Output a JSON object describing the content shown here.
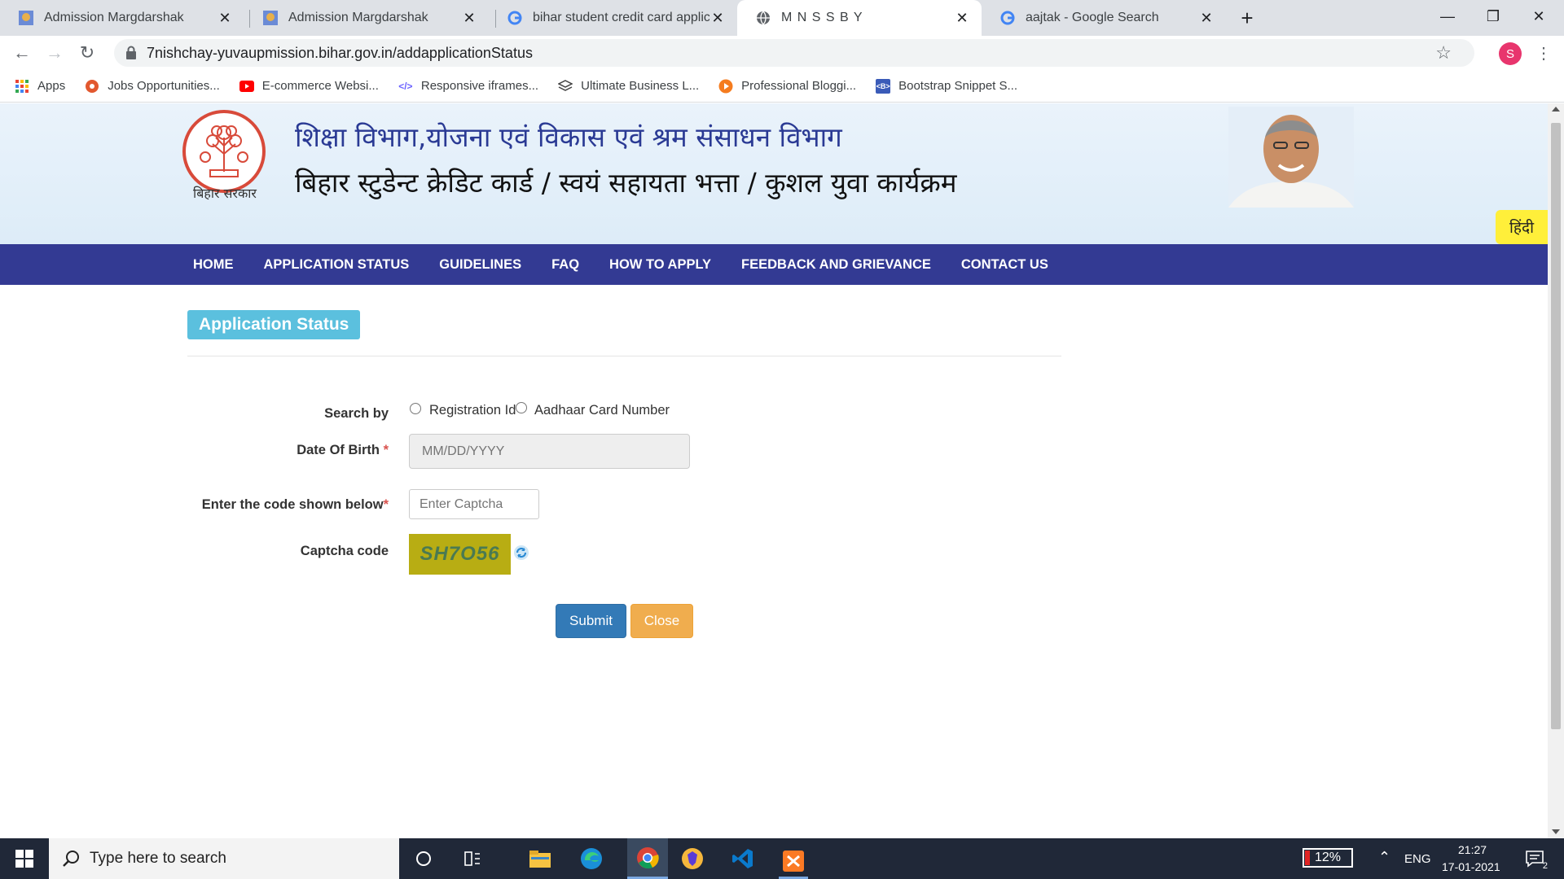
{
  "browser": {
    "tabs": [
      {
        "title": "Admission Margdarshak",
        "icon": "site-favicon"
      },
      {
        "title": "Admission Margdarshak",
        "icon": "site-favicon"
      },
      {
        "title": "bihar student credit card applicat",
        "icon": "google-g-icon"
      },
      {
        "title": "M N S S B Y",
        "icon": "globe-icon",
        "active": true
      },
      {
        "title": "aajtak - Google Search",
        "icon": "google-g-icon"
      }
    ],
    "url": "7nishchay-yuvaupmission.bihar.gov.in/addapplicationStatus",
    "profile_initial": "S",
    "bookmarks": [
      {
        "label": "Apps",
        "icon": "apps-grid-icon"
      },
      {
        "label": "Jobs Opportunities...",
        "icon": "jobs-icon"
      },
      {
        "label": "E-commerce Websi...",
        "icon": "youtube-icon"
      },
      {
        "label": "Responsive iframes...",
        "icon": "code-icon"
      },
      {
        "label": "Ultimate Business L...",
        "icon": "layers-icon"
      },
      {
        "label": "Professional Bloggi...",
        "icon": "play-circle-icon"
      },
      {
        "label": "Bootstrap Snippet S...",
        "icon": "bootstrap-icon"
      }
    ]
  },
  "header": {
    "emblem_text": "बिहार सरकार",
    "department": "शिक्षा विभाग,योजना एवं विकास एवं श्रम संसाधन विभाग",
    "scheme": "बिहार स्टुडेन्ट क्रेडिट कार्ड / स्वयं सहायता भत्ता / कुशल युवा कार्यक्रम",
    "language_toggle": "हिंदी"
  },
  "nav": {
    "items": [
      "HOME",
      "APPLICATION STATUS",
      "GUIDELINES",
      "FAQ",
      "HOW TO APPLY",
      "FEEDBACK AND GRIEVANCE",
      "CONTACT US"
    ]
  },
  "form": {
    "heading": "Application Status",
    "search_by_label": "Search by",
    "option_registration": "Registration Id",
    "option_aadhaar": "Aadhaar Card Number",
    "dob_label": "Date Of Birth",
    "dob_placeholder": "MM/DD/YYYY",
    "captcha_input_label": "Enter the code shown below",
    "captcha_placeholder": "Enter Captcha",
    "captcha_label": "Captcha code",
    "captcha_value": "SH7O56",
    "required_mark": "*",
    "submit_label": "Submit",
    "close_label": "Close"
  },
  "taskbar": {
    "search_placeholder": "Type here to search",
    "battery": "12%",
    "language": "ENG",
    "time": "21:27",
    "date": "17-01-2021",
    "notifications": "2"
  },
  "colors": {
    "nav_bg": "#333a93",
    "heading_badge": "#5bc0de",
    "submit": "#337ab7",
    "close": "#f0ad4e",
    "language_toggle": "#ffef3a"
  }
}
